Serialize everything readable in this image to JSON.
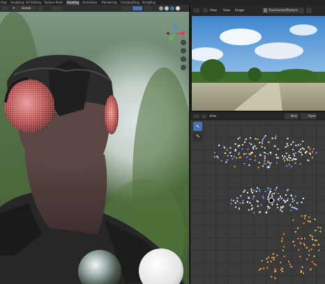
{
  "topbar": {
    "tabs": [
      "ting",
      "Sculpting",
      "UV Editing",
      "Texture Paint",
      "Shading",
      "Animation",
      "Rendering",
      "Compositing",
      "Scripting"
    ],
    "active_tab": "Shading"
  },
  "viewport_header": {
    "transform_orientation": "Global"
  },
  "image_editor": {
    "menu": [
      "View",
      "View",
      "Image"
    ],
    "image_name": "EnvironmentTexture"
  },
  "shader_editor": {
    "menu": [
      "View"
    ],
    "new_button": "New",
    "open_button": "Open"
  },
  "colors": {
    "accent": "#4772b3",
    "active_tab": "#4b4b4b",
    "header_bg": "#262626",
    "shader_grid": "#3b3b3b"
  }
}
